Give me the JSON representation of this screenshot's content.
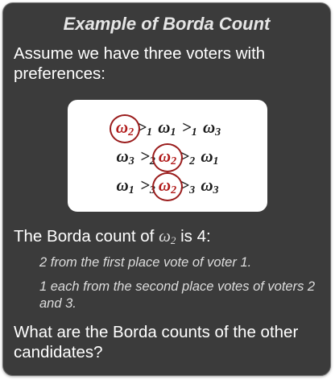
{
  "title": "Example of Borda Count",
  "intro": "Assume we have three voters with preferences:",
  "preferences": [
    {
      "first": "ω",
      "first_sub": "2",
      "rel1": ">",
      "rel1_sub": "1",
      "second": "ω",
      "second_sub": "1",
      "rel2": ">",
      "rel2_sub": "1",
      "third": "ω",
      "third_sub": "3",
      "highlight": "first"
    },
    {
      "first": "ω",
      "first_sub": "3",
      "rel1": ">",
      "rel1_sub": "2",
      "second": "ω",
      "second_sub": "2",
      "rel2": ">",
      "rel2_sub": "2",
      "third": "ω",
      "third_sub": "1",
      "highlight": "second"
    },
    {
      "first": "ω",
      "first_sub": "1",
      "rel1": ">",
      "rel1_sub": "3",
      "second": "ω",
      "second_sub": "2",
      "rel2": ">",
      "rel2_sub": "3",
      "third": "ω",
      "third_sub": "3",
      "highlight": "second"
    }
  ],
  "statement": {
    "prefix": "The Borda count of",
    "symbol": "ω",
    "symbol_sub": "2",
    "suffix": "is 4:"
  },
  "points": [
    "2 from the first place vote of voter 1.",
    "1 each from the second place votes of voters 2 and 3."
  ],
  "question": "What are the Borda counts of the other candidates?",
  "colors": {
    "card_background": "#3b3b3b",
    "highlight": "#b11a1a",
    "circle": "#9a1c1c"
  }
}
